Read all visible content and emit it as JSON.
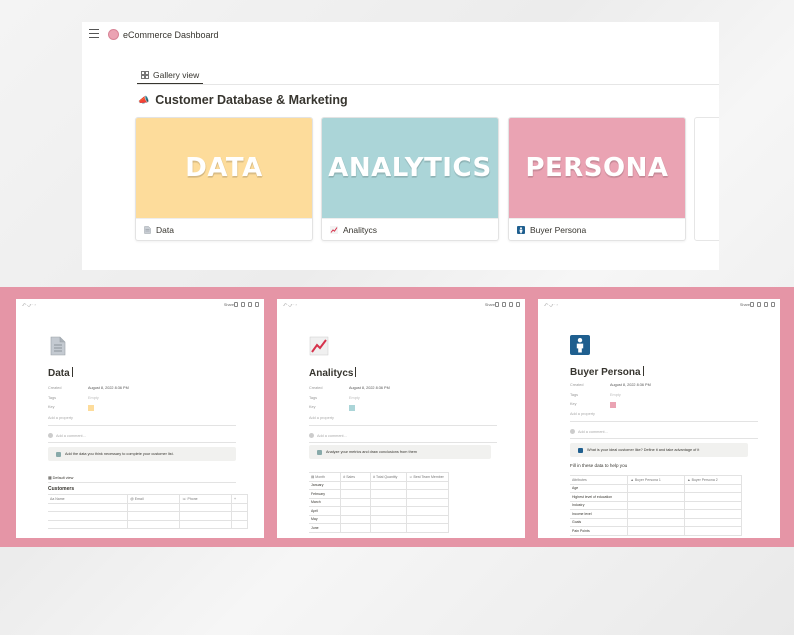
{
  "window": {
    "title": "eCommerce Dashboard",
    "view_tab": "Gallery view",
    "db_title": "Customer Database & Marketing",
    "db_emoji": "📣"
  },
  "cards": [
    {
      "cover_text": "DATA",
      "cover_color": "#fddc9b",
      "label": "Data",
      "icon": "document-icon"
    },
    {
      "cover_text": "ANALYTICS",
      "cover_color": "#abd5d8",
      "label": "Analitycs",
      "icon": "chart-up-icon"
    },
    {
      "cover_text": "PERSONA",
      "cover_color": "#eaa3b3",
      "label": "Buyer Persona",
      "icon": "person-icon"
    }
  ],
  "colors": {
    "band": "#e595a6",
    "accent_blue": "#1f5f8f"
  },
  "panel_common": {
    "share": "Share",
    "created_key": "Created",
    "created_val": "August 8, 2022 8:36 PM",
    "tags_key": "Tags",
    "tags_val": "Empty",
    "key_key": "Key",
    "add_property": "Add a property",
    "add_comment": "Add a comment..."
  },
  "panels": [
    {
      "title": "Data",
      "swatch": "#fddc9b",
      "callout": "Add the data you think necessary to complete your customer list.",
      "view_tab": "Default view",
      "table_title": "Customers",
      "columns": [
        "Name",
        "Email",
        "Phone"
      ]
    },
    {
      "title": "Analitycs",
      "swatch": "#abd5d8",
      "callout": "Analyze your metrics and draw conclusions from them",
      "columns": [
        "Month",
        "Sales",
        "Total Quantity",
        "Best Team Member"
      ],
      "rows": [
        "January",
        "February",
        "March",
        "April",
        "May",
        "June"
      ]
    },
    {
      "title": "Buyer Persona",
      "swatch": "#eaa3b3",
      "callout": "What is your ideal customer like? Define it and take advantage of it",
      "fill_heading": "Fill in these data to help you",
      "columns": [
        "Attributes",
        "Buyer Persona 1",
        "Buyer Persona 2"
      ],
      "rows": [
        "Age",
        "Highest level of education",
        "Industry",
        "Income level",
        "Goals",
        "Pain Points"
      ]
    }
  ]
}
